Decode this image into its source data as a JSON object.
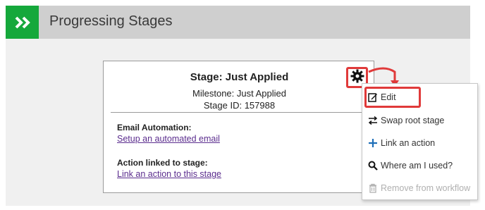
{
  "header": {
    "title": "Progressing Stages",
    "icon": "double-chevron-right-icon",
    "accent": "#15a83b"
  },
  "stage": {
    "title": "Stage: Just Applied",
    "milestone": "Milestone: Just Applied",
    "stage_id": "Stage ID: 157988",
    "email_label": "Email Automation:",
    "email_link": "Setup an automated email",
    "action_label": "Action linked to stage:",
    "action_link": "Link an action to this stage"
  },
  "menu": {
    "items": [
      {
        "label": "Edit",
        "icon": "edit-icon"
      },
      {
        "label": "Swap root stage",
        "icon": "swap-icon"
      },
      {
        "label": "Link an action",
        "icon": "plus-icon"
      },
      {
        "label": "Where am I used?",
        "icon": "search-icon"
      },
      {
        "label": "Remove from workflow",
        "icon": "trash-icon",
        "disabled": true
      }
    ]
  },
  "colors": {
    "highlight": "#e03a3a",
    "link": "#5b2d8e"
  }
}
